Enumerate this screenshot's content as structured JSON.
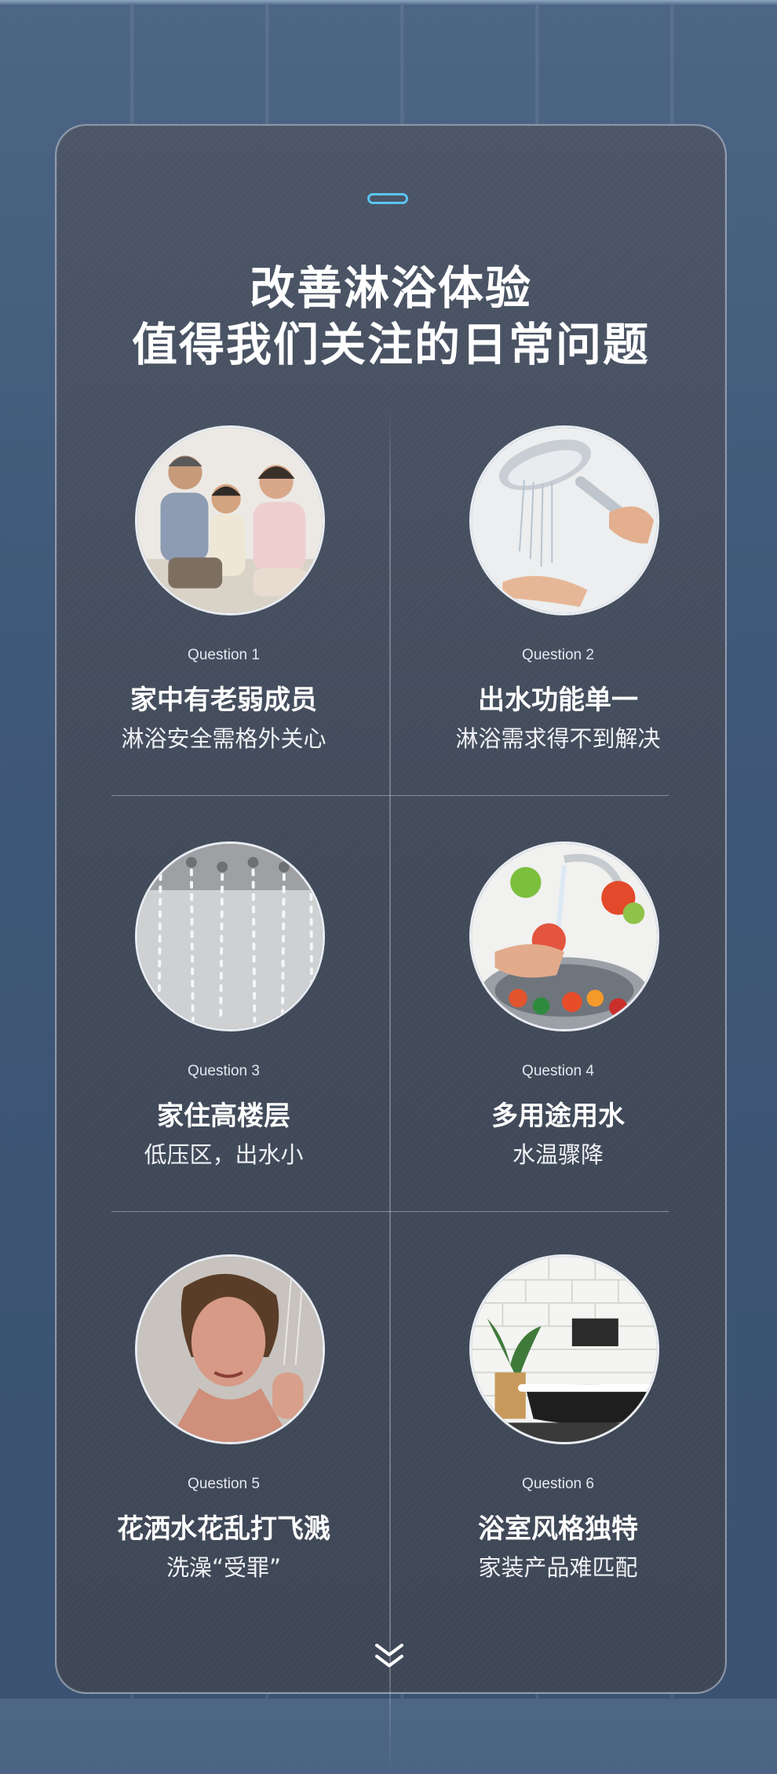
{
  "heading": {
    "line1": "改善淋浴体验",
    "line2": "值得我们关注的日常问题"
  },
  "questions": [
    {
      "label": "Question 1",
      "title": "家中有老弱成员",
      "desc": "淋浴安全需格外关心",
      "image": "family-photo"
    },
    {
      "label": "Question 2",
      "title": "出水功能单一",
      "desc": "淋浴需求得不到解决",
      "image": "shower-head-photo"
    },
    {
      "label": "Question 3",
      "title": "家住高楼层",
      "desc": "低压区，出水小",
      "image": "rain-shower-photo"
    },
    {
      "label": "Question 4",
      "title": "多用途用水",
      "desc": "水温骤降",
      "image": "washing-vegetables-photo"
    },
    {
      "label": "Question 5",
      "title": "花洒水花乱打飞溅",
      "desc": "洗澡“受罪”",
      "image": "woman-showering-photo"
    },
    {
      "label": "Question 6",
      "title": "浴室风格独特",
      "desc": "家装产品难匹配",
      "image": "bathroom-photo"
    }
  ],
  "colors": {
    "background": "#43597a",
    "card": "#454e5e",
    "accent_pill": "#59c6f2",
    "text": "#ffffff"
  },
  "icons": {
    "top": "pill-indicator",
    "bottom": "double-chevron-down-icon"
  }
}
